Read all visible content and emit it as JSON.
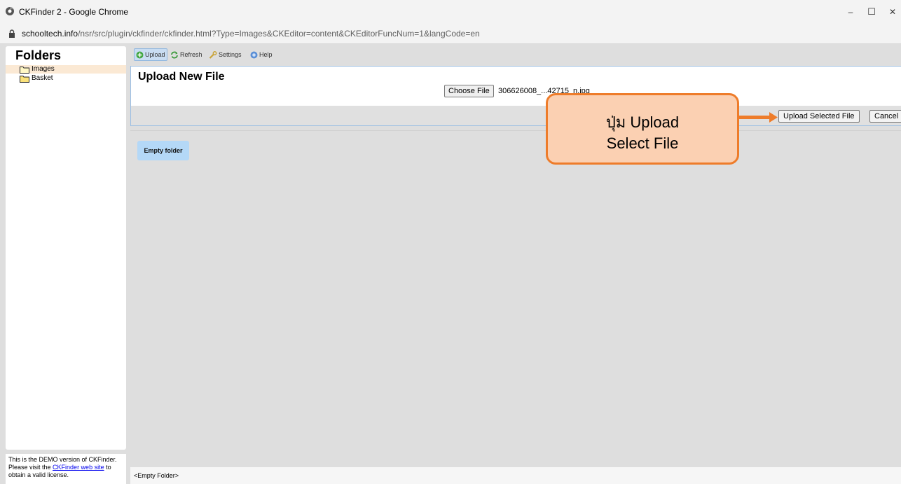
{
  "window": {
    "title": "CKFinder 2 - Google Chrome",
    "minimize": "–",
    "maximize": "☐",
    "close": "✕"
  },
  "address": {
    "host": "schooltech.info",
    "path": "/nsr/src/plugin/ckfinder/ckfinder.html?Type=Images&CKEditor=content&CKEditorFuncNum=1&langCode=en"
  },
  "sidebar": {
    "heading": "Folders",
    "folders": [
      {
        "label": "Images",
        "selected": true
      },
      {
        "label": "Basket",
        "selected": false
      }
    ]
  },
  "toolbar": {
    "upload": "Upload",
    "refresh": "Refresh",
    "settings": "Settings",
    "help": "Help"
  },
  "upload_panel": {
    "title": "Upload New File",
    "choose_file": "Choose File",
    "filename": "306626008_...42715_n.jpg",
    "upload_selected": "Upload Selected File",
    "cancel": "Cancel"
  },
  "files": {
    "empty_tile": "Empty folder",
    "status": "<Empty Folder>"
  },
  "demo_note": {
    "text1": "This is the DEMO version of CKFinder.",
    "text2": "Please visit the",
    "link": "CKFinder web site",
    "text3": "to",
    "text4": "obtain a valid license."
  },
  "annotation": {
    "line1": "ปุ่ม Upload",
    "line2": "Select File"
  },
  "colors": {
    "callout_fill": "#fbd0b2",
    "callout_border": "#ee7c2a",
    "arrow": "#ee7c2a",
    "selected_folder": "#fbe9d4"
  }
}
